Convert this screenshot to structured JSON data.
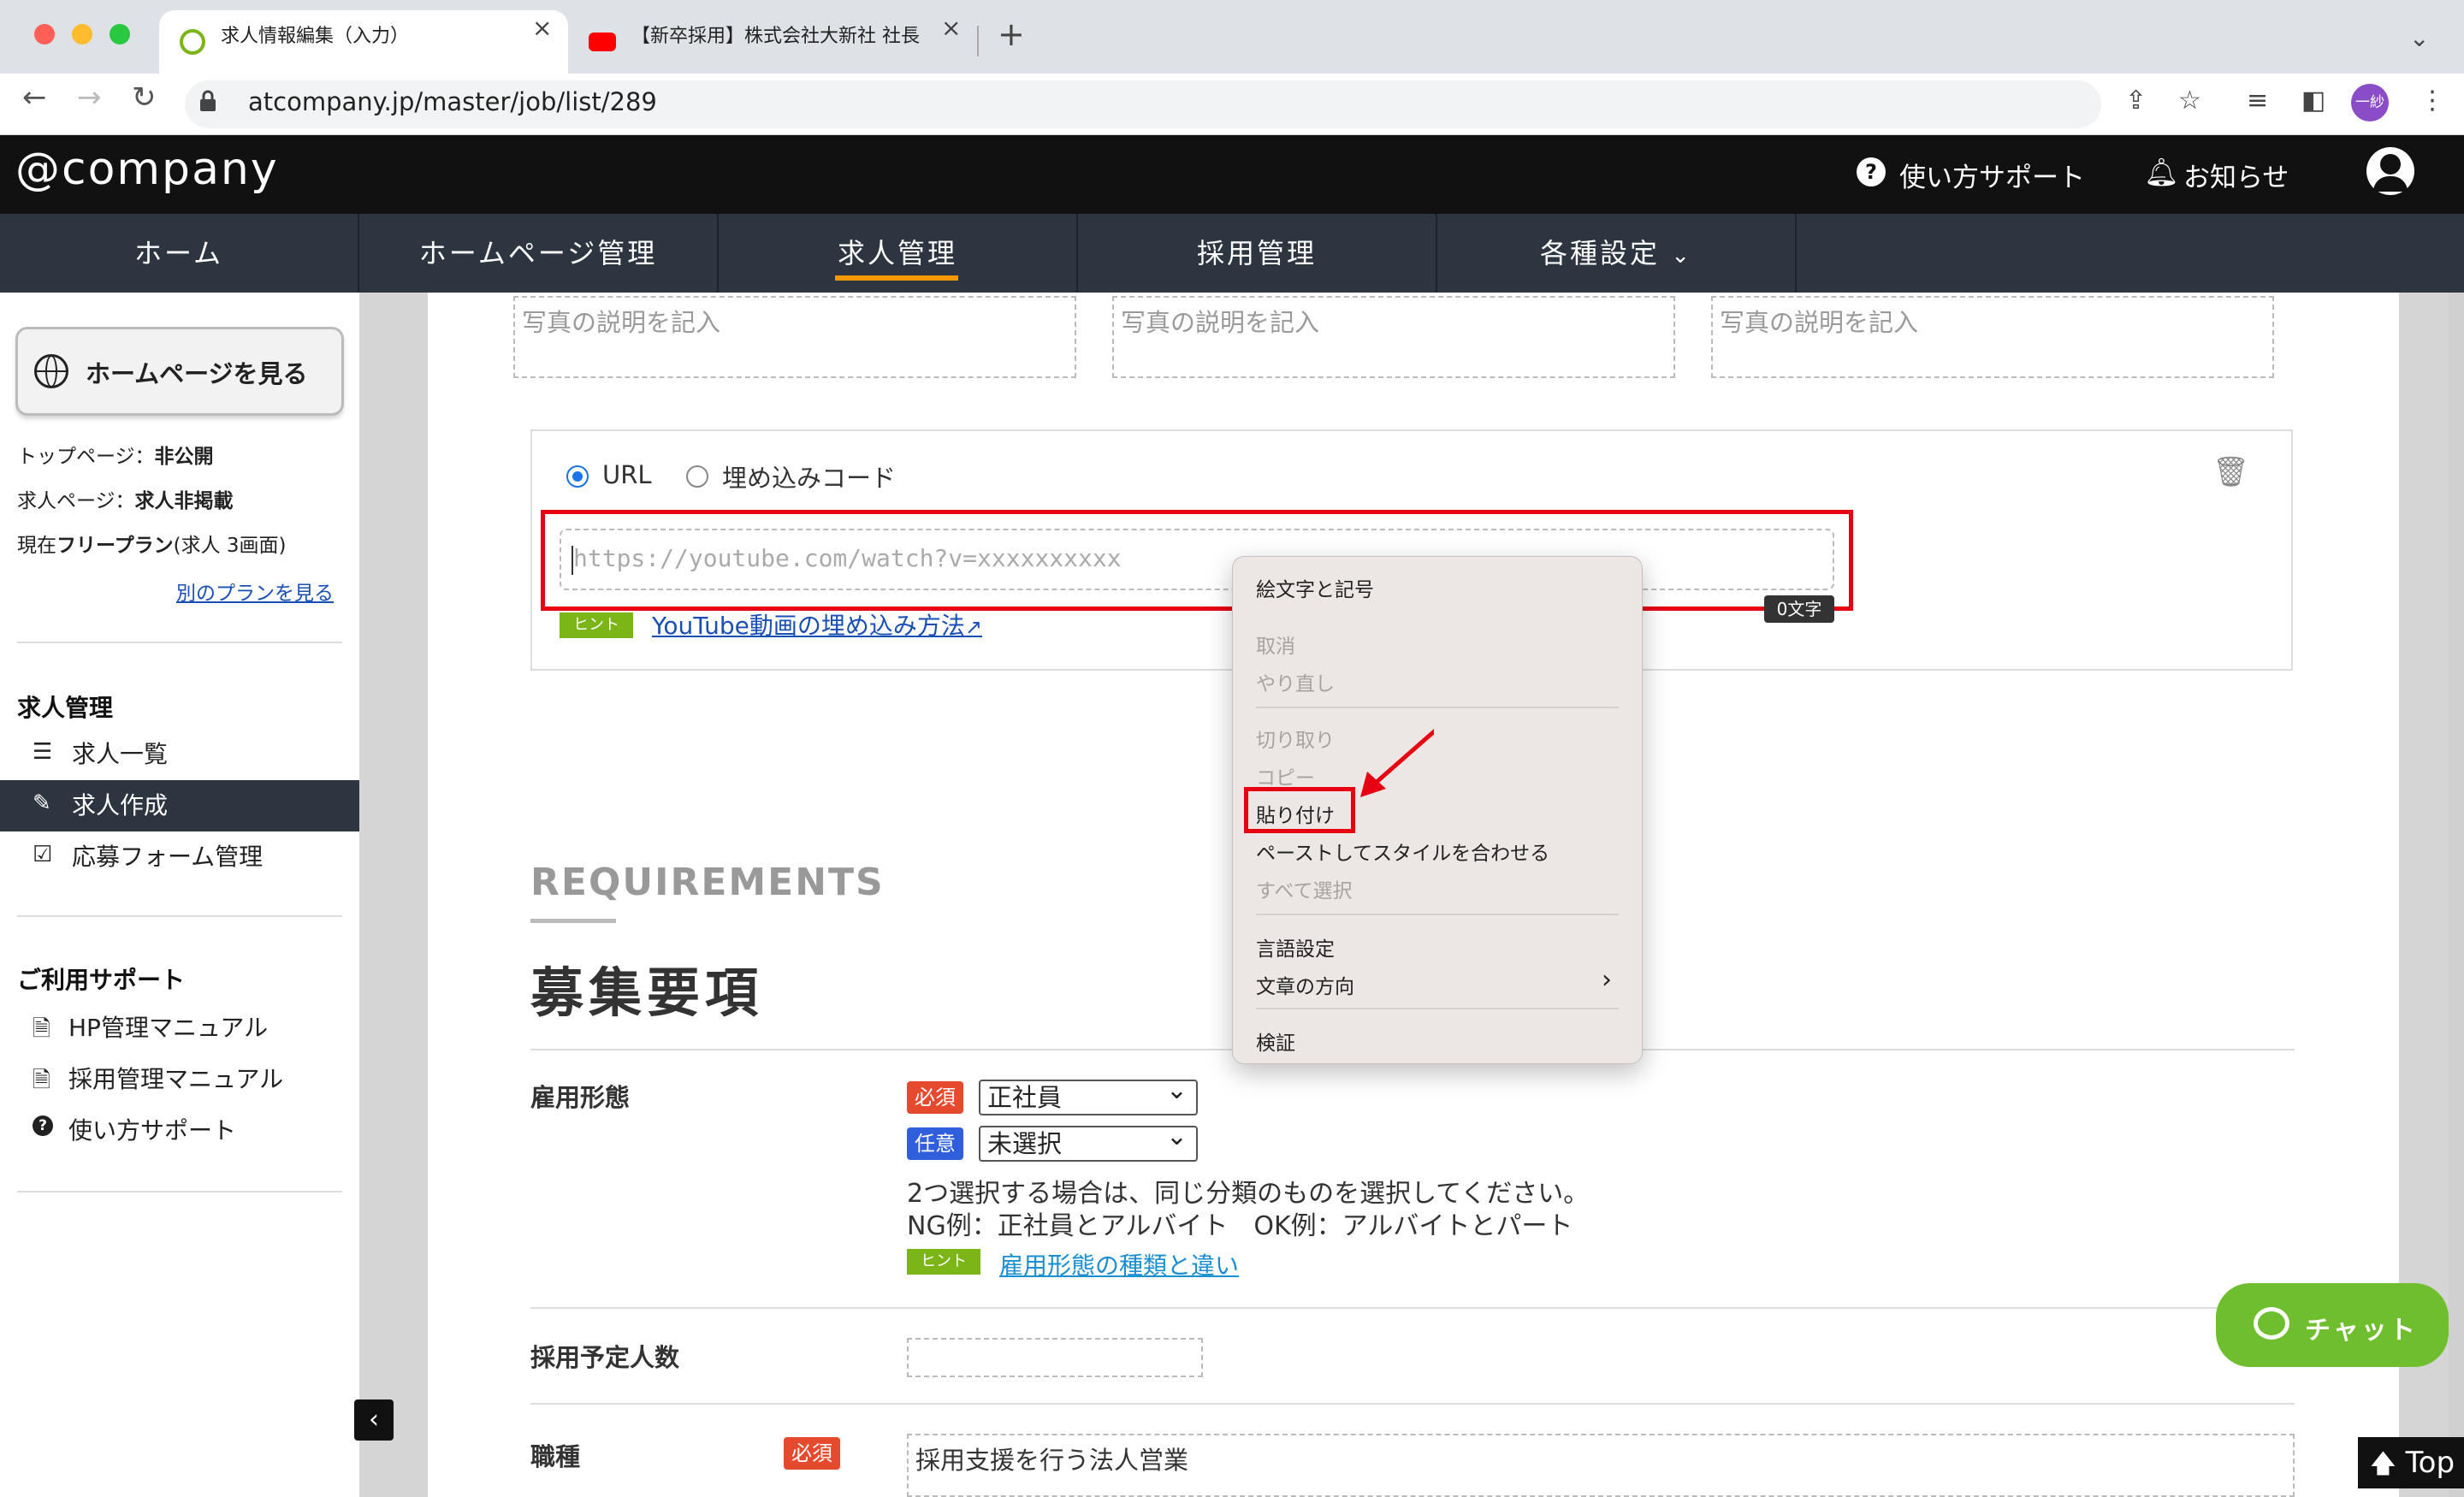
{
  "browser": {
    "tabs": [
      {
        "title": "求人情報編集（入力）",
        "active": true
      },
      {
        "title": "【新卒採用】株式会社大新社 社長",
        "active": false
      }
    ],
    "url": "atcompany.jp/master/job/list/289",
    "profile_initials": "一紗"
  },
  "site": {
    "logo": "@company",
    "header_links": {
      "support": "使い方サポート",
      "notice": "お知らせ"
    },
    "nav": [
      "ホーム",
      "ホームページ管理",
      "求人管理",
      "採用管理",
      "各種設定"
    ],
    "nav_active": "求人管理"
  },
  "sidebar": {
    "hp_button": "ホームページを見る",
    "status": {
      "top_page_label": "トップページ：",
      "top_page_value": "非公開",
      "job_page_label": "求人ページ：",
      "job_page_value": "求人非掲載",
      "plan_prefix": "現在",
      "plan_name": "フリープラン",
      "plan_suffix": "(求人 3画面)"
    },
    "other_plan_link": "別のプランを見る",
    "section1_title": "求人管理",
    "section1_items": [
      "求人一覧",
      "求人作成",
      "応募フォーム管理"
    ],
    "section1_active": "求人作成",
    "section2_title": "ご利用サポート",
    "section2_items": [
      "HP管理マニュアル",
      "採用管理マニュアル",
      "使い方サポート"
    ]
  },
  "main": {
    "photo_placeholder": "写真の説明を記入",
    "video": {
      "radio_url": "URL",
      "radio_embed": "埋め込みコード",
      "selected": "URL",
      "url_placeholder": "https://youtube.com/watch?v=xxxxxxxxxx",
      "char_count": "0文字",
      "hint_label": "ヒント",
      "hint_link": "YouTube動画の埋め込み方法"
    },
    "requirements_en": "REQUIREMENTS",
    "requirements_jp": "募集要項",
    "employment": {
      "label": "雇用形態",
      "required_badge": "必須",
      "optional_badge": "任意",
      "primary_value": "正社員",
      "secondary_value": "未選択",
      "note1": "2つ選択する場合は、同じ分類のものを選択してください。",
      "note2": "NG例：正社員とアルバイト　OK例：アルバイトとパート",
      "hint_label": "ヒント",
      "hint_link": "雇用形態の種類と違い"
    },
    "headcount": {
      "label": "採用予定人数",
      "value": ""
    },
    "job_type": {
      "label": "職種",
      "required_badge": "必須",
      "value": "採用支援を行う法人営業"
    }
  },
  "context_menu": {
    "items": [
      {
        "label": "絵文字と記号",
        "enabled": true
      },
      {
        "label": "取消",
        "enabled": false
      },
      {
        "label": "やり直し",
        "enabled": false
      },
      {
        "label": "切り取り",
        "enabled": false
      },
      {
        "label": "コピー",
        "enabled": false
      },
      {
        "label": "貼り付け",
        "enabled": true,
        "highlighted": true
      },
      {
        "label": "ペーストしてスタイルを合わせる",
        "enabled": true
      },
      {
        "label": "すべて選択",
        "enabled": false
      },
      {
        "label": "言語設定",
        "enabled": true
      },
      {
        "label": "文章の方向",
        "enabled": true,
        "submenu": true
      },
      {
        "label": "検証",
        "enabled": true
      }
    ]
  },
  "floating": {
    "chat": "チャット",
    "top": "Top"
  },
  "colors": {
    "accent_red": "#e60012",
    "nav_bg": "#2c3540",
    "chat_green": "#6fbe2e",
    "active_underline": "#f39800"
  }
}
